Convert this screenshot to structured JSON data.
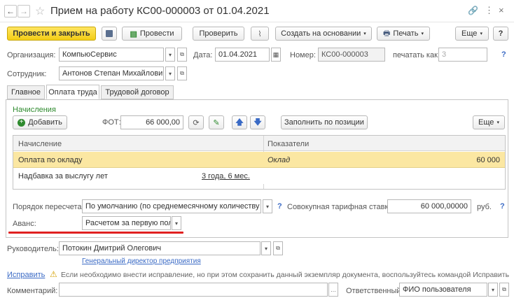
{
  "title": "Прием на работу КС00-000003 от 01.04.2021",
  "toolbar": {
    "post_close": "Провести и закрыть",
    "post": "Провести",
    "check": "Проверить",
    "create_based": "Создать на основании",
    "print": "Печать",
    "more": "Еще",
    "help": "?"
  },
  "header": {
    "org_label": "Организация:",
    "org_value": "КомпьюСервис",
    "date_label": "Дата:",
    "date_value": "01.04.2021",
    "number_label": "Номер:",
    "number_value": "КС00-000003",
    "print_as_label": "печатать как:",
    "print_as_value": "3",
    "employee_label": "Сотрудник:",
    "employee_value": "Антонов Степан Михайлович"
  },
  "tabs": [
    "Главное",
    "Оплата труда",
    "Трудовой договор"
  ],
  "accruals": {
    "section_title": "Начисления",
    "add_label": "Добавить",
    "fot_label": "ФОТ:",
    "fot_value": "66 000,00",
    "fill_label": "Заполнить по позиции",
    "more_label": "Еще",
    "col_accrual": "Начисление",
    "col_indicators": "Показатели",
    "rows": [
      {
        "name": "Оплата по окладу",
        "detail": "",
        "indicator": "Оклад",
        "value": "60 000"
      },
      {
        "name": "Надбавка за выслугу лет",
        "detail": "3 года, 6 мес.",
        "indicator": "",
        "value": ""
      }
    ]
  },
  "recalc": {
    "label": "Порядок пересчета:",
    "value": "По умолчанию (по среднемесячному количеству часо",
    "total_label": "Совокупная тарифная ставка:",
    "total_value": "60 000,00000",
    "currency": "руб."
  },
  "advance": {
    "label": "Аванс:",
    "value": "Расчетом за первую полов"
  },
  "footer": {
    "manager_label": "Руководитель:",
    "manager_value": "Потокин Дмитрий Олегович",
    "manager_position": "Генеральный директор предприятия",
    "fix_link": "Исправить",
    "fix_note": "Если необходимо внести исправление, но при этом сохранить данный экземпляр документа, воспользуйтесь командой Исправить",
    "comment_label": "Комментарий:",
    "comment_value": "",
    "responsible_label": "Ответственный:",
    "responsible_value": "ФИО пользователя"
  },
  "colors": {
    "accent_yellow": "#f3cd16",
    "selected_row": "#fbe7a2",
    "underline_red": "#e02020",
    "link_blue": "#3a6ac5",
    "section_green": "#2e8a2e"
  }
}
